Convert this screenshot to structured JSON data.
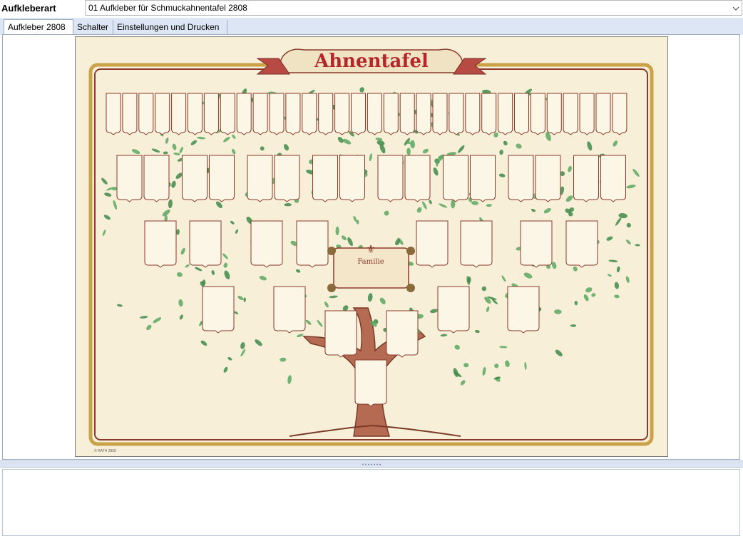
{
  "header": {
    "field_label": "Aufkleberart",
    "selected_value": "01 Aufkleber für Schmuckahnentafel 2808"
  },
  "tabs": [
    {
      "label": "Aufkleber 2808",
      "active": true
    },
    {
      "label": "Schalter",
      "active": false
    },
    {
      "label": "Einstellungen und Drucken",
      "active": false
    }
  ],
  "preview": {
    "title": "Ahnentafel",
    "center_label": "Familie",
    "footer_mark": "© RATH 2808"
  },
  "colors": {
    "tab_strip": "#dce6f4",
    "paper": "#f7efd8",
    "frame": "#8b3a2a",
    "frame_gold": "#c9a24a",
    "title_red": "#b3262a",
    "leaf_green": "#3f8a4a",
    "trunk_brown": "#a0523c"
  },
  "icons": {
    "combo_arrow": "chevron-down-icon",
    "splitter_grip": "grip-dots-icon"
  }
}
